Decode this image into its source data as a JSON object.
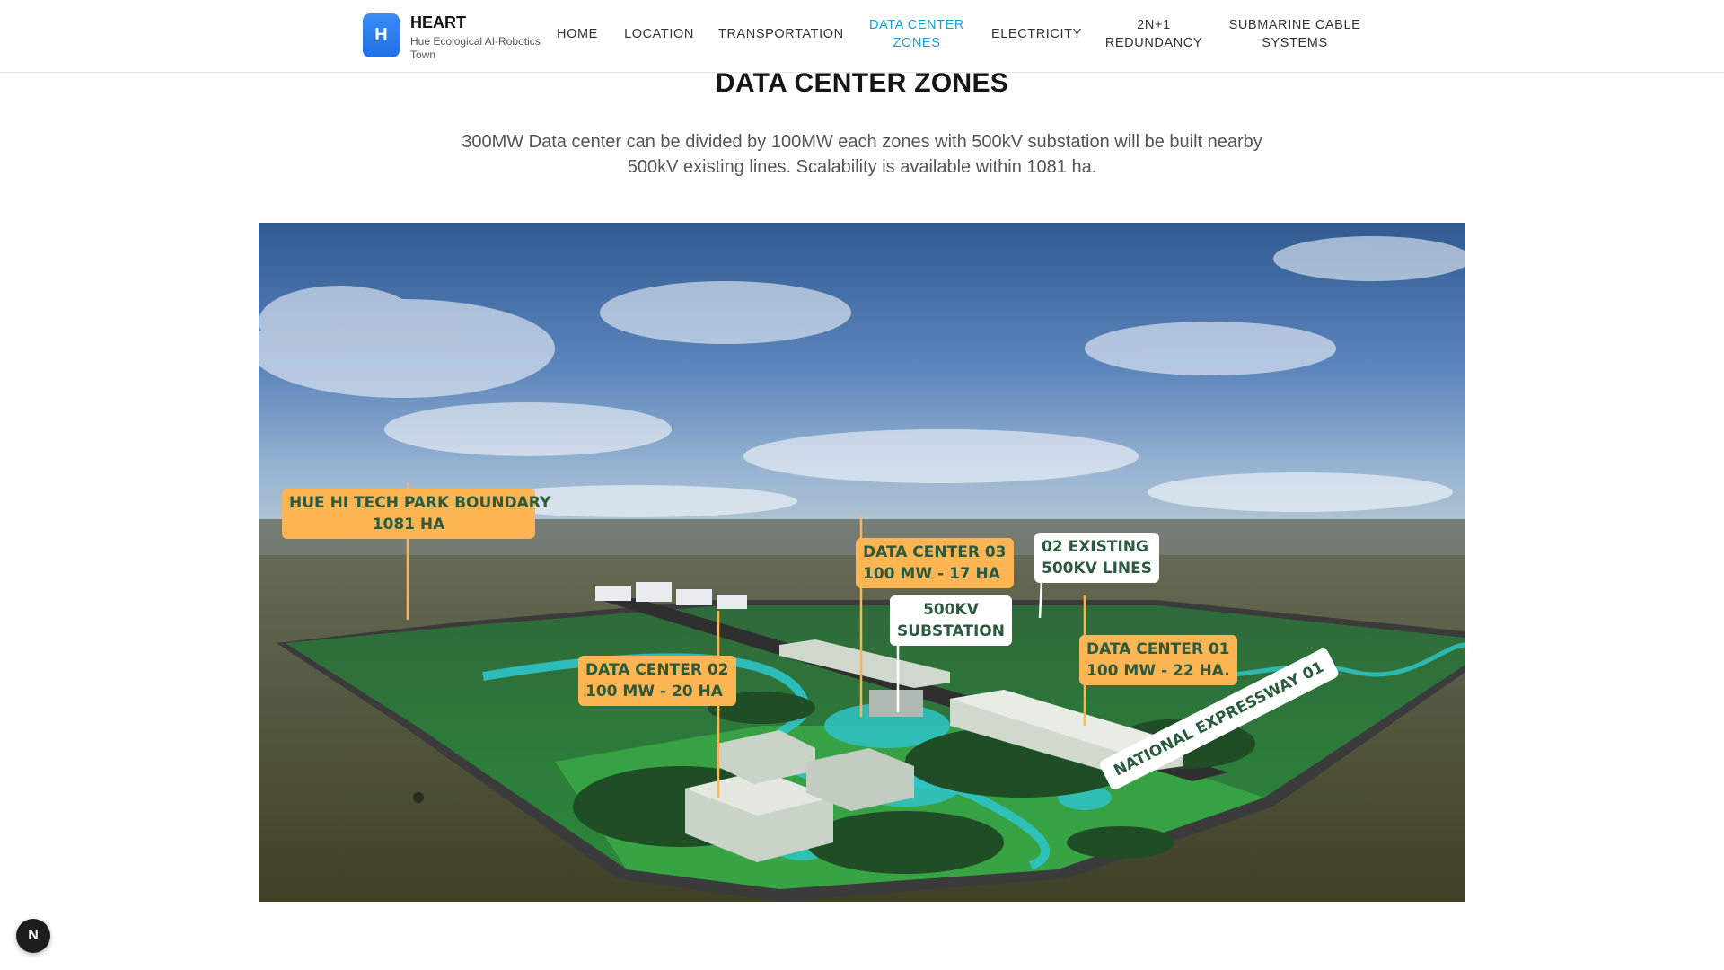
{
  "brand": {
    "logo_letter": "H",
    "title": "HEART",
    "subtitle": "Hue Ecological AI-Robotics Town"
  },
  "nav": {
    "items": [
      {
        "label": "HOME"
      },
      {
        "label": "LOCATION"
      },
      {
        "label": "TRANSPORTATION"
      },
      {
        "label": "DATA CENTER ZONES",
        "active": true
      },
      {
        "label": "ELECTRICITY"
      },
      {
        "label": "2N+1 REDUNDANCY"
      },
      {
        "label": "SUBMARINE CABLE SYSTEMS"
      }
    ]
  },
  "main": {
    "title": "DATA CENTER ZONES",
    "description": "300MW Data center can be divided by 100MW each zones with 500kV substation will be built nearby 500kV existing lines. Scalability is available within 1081 ha."
  },
  "map": {
    "labels": {
      "boundary": {
        "line1": "HUE HI TECH PARK BOUNDARY",
        "line2": "1081 HA"
      },
      "dc03": {
        "line1": "DATA CENTER 03",
        "line2": "100 MW - 17 HA"
      },
      "existing_lines": {
        "line1": "02 EXISTING",
        "line2": "500KV LINES"
      },
      "substation": {
        "line1": "500KV",
        "line2": "SUBSTATION"
      },
      "dc02": {
        "line1": "DATA CENTER 02",
        "line2": "100 MW - 20 HA"
      },
      "dc01": {
        "line1": "DATA CENTER 01",
        "line2": "100 MW - 22 HA."
      },
      "expressway": "NATIONAL  EXPRESSWAY  01"
    }
  },
  "fab": {
    "letter": "N"
  },
  "colors": {
    "accent": "#1f9bd6",
    "callout_orange": "#fbb552",
    "callout_text": "#2c5a3e",
    "logo_blue": "#2a7ef0"
  }
}
